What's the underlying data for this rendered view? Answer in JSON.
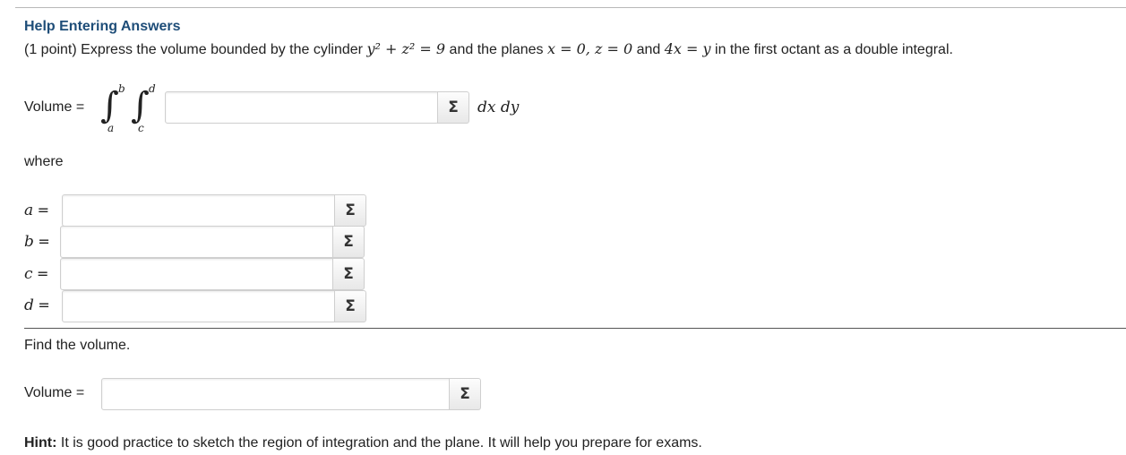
{
  "help_link": "Help Entering Answers",
  "problem": {
    "points": "(1 point) Express the volume bounded by the cylinder",
    "cylinder_eq": "y² + z² = 9",
    "and_the_planes": "and the planes",
    "plane_1": "x = 0, z = 0",
    "and": "and",
    "plane_2": "4x = y",
    "tail": "in the first octant as a double integral."
  },
  "integral": {
    "label": "Volume =",
    "outer_upper": "b",
    "outer_lower": "a",
    "inner_upper": "d",
    "inner_lower": "c",
    "differentials": "dx dy",
    "value": ""
  },
  "where_label": "where",
  "limits": [
    {
      "var": "a",
      "eq": "=",
      "value": ""
    },
    {
      "var": "b",
      "eq": "=",
      "value": ""
    },
    {
      "var": "c",
      "eq": "=",
      "value": ""
    },
    {
      "var": "d",
      "eq": "=",
      "value": ""
    }
  ],
  "find_volume": "Find the volume.",
  "volume": {
    "label": "Volume =",
    "value": ""
  },
  "sigma": "Σ",
  "hint": {
    "prefix": "Hint:",
    "text": "It is good practice to sketch the region of integration and the plane. It will help you prepare for exams."
  }
}
